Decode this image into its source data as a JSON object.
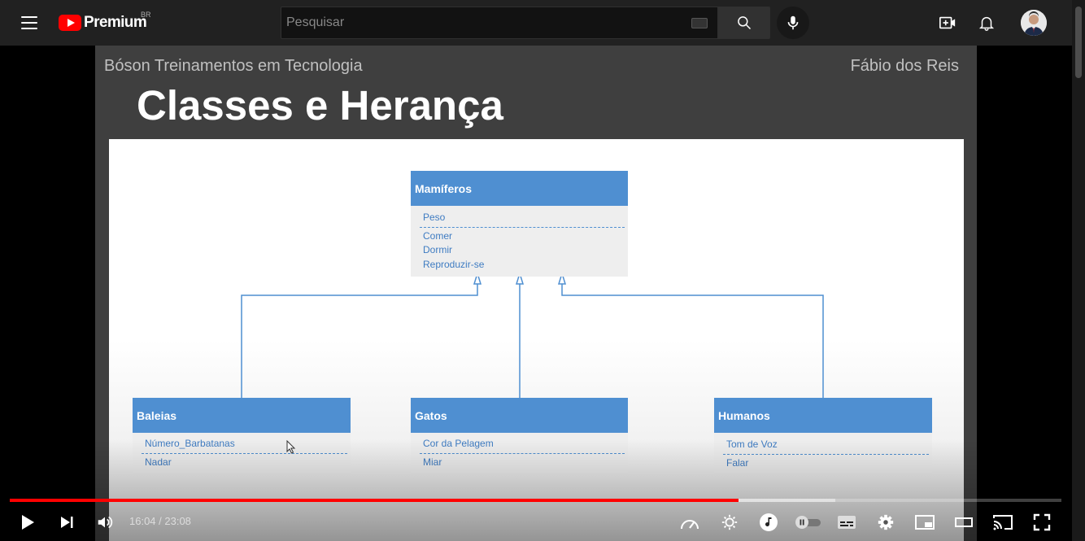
{
  "header": {
    "logo_text": "Premium",
    "country_code": "BR",
    "search_placeholder": "Pesquisar"
  },
  "slide": {
    "organization": "Bóson Treinamentos em Tecnologia",
    "author": "Fábio dos Reis",
    "title": "Classes e Herança"
  },
  "diagram": {
    "parent": {
      "name": "Mamíferos",
      "attributes": [
        "Peso"
      ],
      "methods": [
        "Comer",
        "Dormir",
        "Reproduzir-se"
      ]
    },
    "children": [
      {
        "name": "Baleias",
        "attributes": [
          "Número_Barbatanas"
        ],
        "methods": [
          "Nadar"
        ]
      },
      {
        "name": "Gatos",
        "attributes": [
          "Cor da Pelagem"
        ],
        "methods": [
          "Miar"
        ]
      },
      {
        "name": "Humanos",
        "attributes": [
          "Tom de Voz"
        ],
        "methods": [
          "Falar"
        ]
      }
    ]
  },
  "player": {
    "current_time": "16:04",
    "duration": "23:08",
    "time_display": "16:04 / 23:08",
    "played_fraction": 0.6931,
    "buffered_fraction": 0.785,
    "accent_color": "#ff0000"
  },
  "icons": [
    "menu-icon",
    "youtube-logo-icon",
    "keyboard-icon",
    "search-icon",
    "mic-icon",
    "create-icon",
    "bell-icon",
    "play-icon",
    "next-icon",
    "volume-icon",
    "speed-icon",
    "settings-icon",
    "music-icon",
    "autoplay-toggle-icon",
    "subtitles-icon",
    "miniplayer-icon",
    "theater-icon",
    "cast-icon",
    "fullscreen-icon"
  ]
}
